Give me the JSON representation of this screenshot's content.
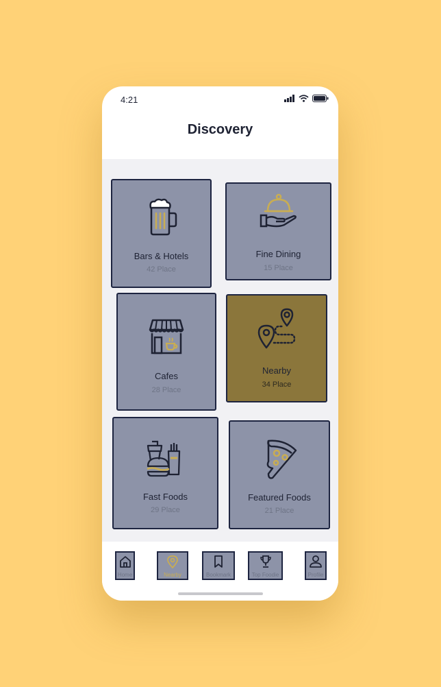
{
  "status_bar": {
    "time": "4:21"
  },
  "header": {
    "title": "Discovery"
  },
  "categories": [
    {
      "title": "Bars  & Hotels",
      "subtitle": "42 Place",
      "icon": "beer-mug-icon"
    },
    {
      "title": "Fine Dining",
      "subtitle": "15 Place",
      "icon": "serving-cloche-icon"
    },
    {
      "title": "Cafes",
      "subtitle": "28 Place",
      "icon": "cafe-storefront-icon"
    },
    {
      "title": "Nearby",
      "subtitle": "34 Place",
      "icon": "route-pins-icon",
      "selected": true
    },
    {
      "title": "Fast Foods",
      "subtitle": "29 Place",
      "icon": "burger-drink-icon"
    },
    {
      "title": "Featured Foods",
      "subtitle": "21 Place",
      "icon": "pizza-slice-icon"
    }
  ],
  "tabbar": {
    "items": [
      {
        "label": "Home",
        "icon": "home-icon"
      },
      {
        "label": "Nearby",
        "icon": "location-pin-icon",
        "active": true
      },
      {
        "label": "Bookmark",
        "icon": "bookmark-icon"
      },
      {
        "label": "Top Foodie",
        "icon": "trophy-icon"
      },
      {
        "label": "Profile",
        "icon": "user-icon"
      }
    ]
  },
  "colors": {
    "background": "#ffd277",
    "card_fill": "#8d93a8",
    "card_border": "#1d2440",
    "accent_gold": "#c9ad52",
    "selected_card": "#8b763b",
    "text_dark": "#1e2233"
  }
}
